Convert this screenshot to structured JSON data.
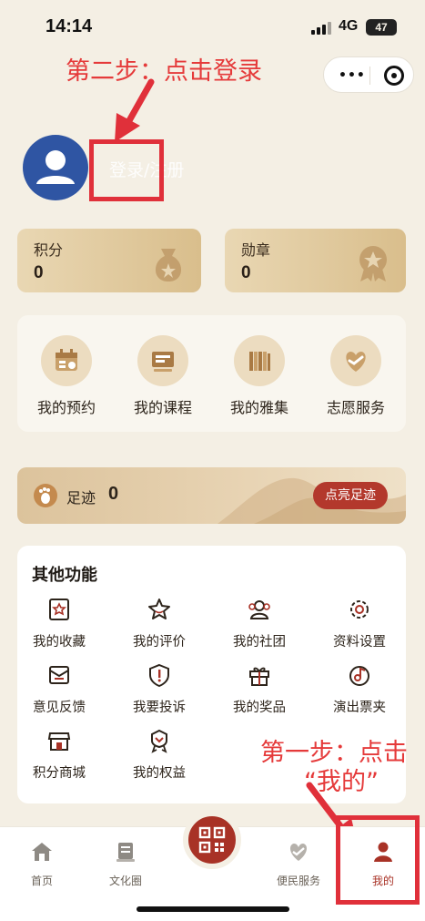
{
  "status_bar": {
    "time": "14:14",
    "network": "4G",
    "battery": "47"
  },
  "annotations": {
    "step2": "第二步：点击登录",
    "step1_line1": "第一步：点击",
    "step1_line2": "“我的”"
  },
  "profile": {
    "login_text": "登录/注册"
  },
  "stats": [
    {
      "label": "积分",
      "value": "0",
      "icon": "money-bag-icon"
    },
    {
      "label": "勋章",
      "value": "0",
      "icon": "medal-icon"
    }
  ],
  "quick_nav": [
    {
      "label": "我的预约",
      "icon": "calendar-icon"
    },
    {
      "label": "我的课程",
      "icon": "course-icon"
    },
    {
      "label": "我的雅集",
      "icon": "books-icon"
    },
    {
      "label": "志愿服务",
      "icon": "heart-handshake-icon"
    }
  ],
  "footprint": {
    "label": "足迹",
    "count": "0",
    "button": "点亮足迹"
  },
  "other_functions": {
    "title": "其他功能",
    "items": [
      {
        "label": "我的收藏",
        "icon": "collect-icon"
      },
      {
        "label": "我的评价",
        "icon": "star-icon"
      },
      {
        "label": "我的社团",
        "icon": "group-icon"
      },
      {
        "label": "资料设置",
        "icon": "gear-icon"
      },
      {
        "label": "意见反馈",
        "icon": "feedback-icon"
      },
      {
        "label": "我要投诉",
        "icon": "complaint-icon"
      },
      {
        "label": "我的奖品",
        "icon": "gift-icon"
      },
      {
        "label": "演出票夹",
        "icon": "ticket-icon"
      },
      {
        "label": "积分商城",
        "icon": "shop-icon"
      },
      {
        "label": "我的权益",
        "icon": "rights-icon"
      }
    ]
  },
  "tabbar": [
    {
      "label": "首页",
      "icon": "home-icon"
    },
    {
      "label": "文化圈",
      "icon": "culture-icon"
    },
    {
      "label": "",
      "icon": "qr-code-icon"
    },
    {
      "label": "便民服务",
      "icon": "service-icon"
    },
    {
      "label": "我的",
      "icon": "user-icon",
      "active": true
    }
  ],
  "colors": {
    "accent": "#a83226",
    "annotation": "#e53a3a",
    "background": "#f4efe4"
  }
}
